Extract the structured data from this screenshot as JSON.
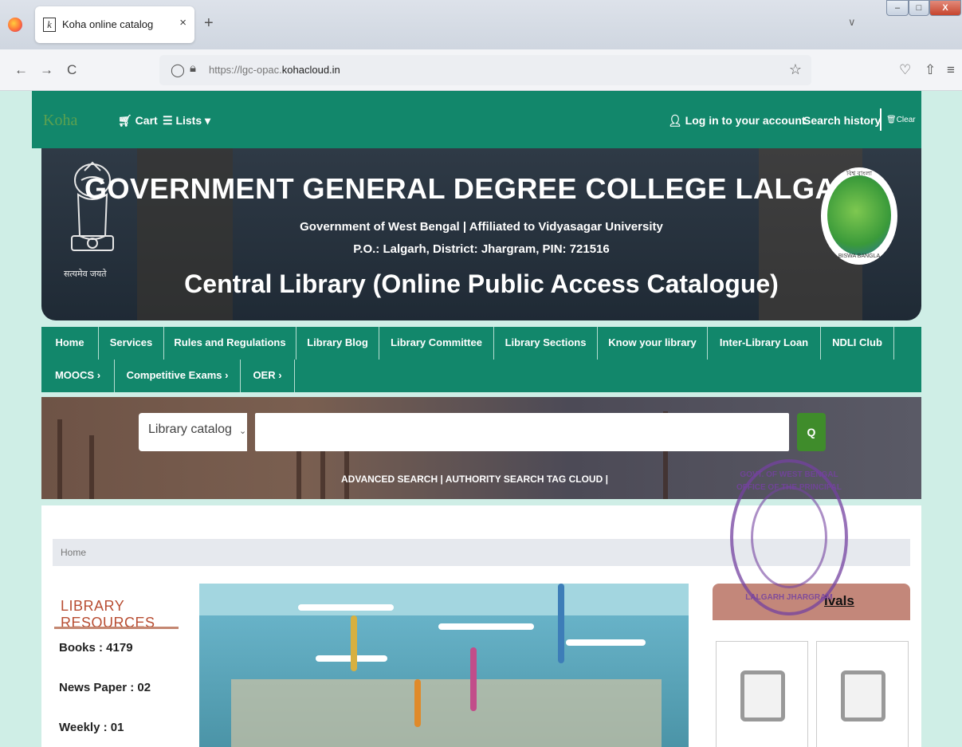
{
  "browser": {
    "tab_title": "Koha online catalog",
    "tab_close": "×",
    "new_tab": "+",
    "tabs_overflow": "∨",
    "url_prefix": "https://lgc-opac.",
    "url_domain": "kohacloud.in",
    "back": "←",
    "forward": "→",
    "reload": "C",
    "star": "☆",
    "pocket": "♡",
    "share": "⇧",
    "menu": "≡",
    "win_min": "–",
    "win_max": "□",
    "win_close": "X"
  },
  "topnav": {
    "logo": "Koha",
    "cart": "Cart",
    "lists": "Lists",
    "login": "Log in to your account",
    "search_history": "Search history",
    "clear": "Clear"
  },
  "banner": {
    "title": "GOVERNMENT GENERAL DEGREE COLLEGE LALGARH",
    "subtitle": "Government of West Bengal | Affiliated to Vidyasagar University",
    "address": "P.O.: Lalgarh, District: Jhargram, PIN: 721516",
    "library": "Central Library (Online Public Access Catalogue)",
    "emblem_motto": "सत्यमेव जयते",
    "logo_top": "বিশ্ব বাংলা",
    "logo_bottom": "BISWA BANGLA"
  },
  "mainnav": {
    "row1": [
      "Home",
      "Services",
      "Rules and Regulations",
      "Library Blog",
      "Library Committee",
      "Library Sections",
      "Know your library",
      "Inter-Library Loan",
      "NDLI Club"
    ],
    "row2": [
      "MOOCS ›",
      "Competitive Exams ›",
      "OER ›"
    ]
  },
  "search": {
    "select_value": "Library catalog",
    "query": "",
    "button_label": "Q",
    "links": "ADVANCED SEARCH | AUTHORITY SEARCH TAG CLOUD |"
  },
  "content": {
    "breadcrumb": "Home",
    "resources_title": "LIBRARY RESOURCES",
    "stats": [
      "Books : 4179",
      "News Paper : 02",
      "Weekly : 01"
    ],
    "arrivals_title": "ivals"
  },
  "stamp": {
    "top": "GOVT. OF WEST BENGAL",
    "middle": "OFFICE OF THE PRINCIPAL",
    "bottom": "LALGARH JHARGRAM"
  },
  "colors": {
    "brand_green": "#12876b",
    "accent_brown": "#b84d32",
    "search_button": "#3f8c2b"
  }
}
